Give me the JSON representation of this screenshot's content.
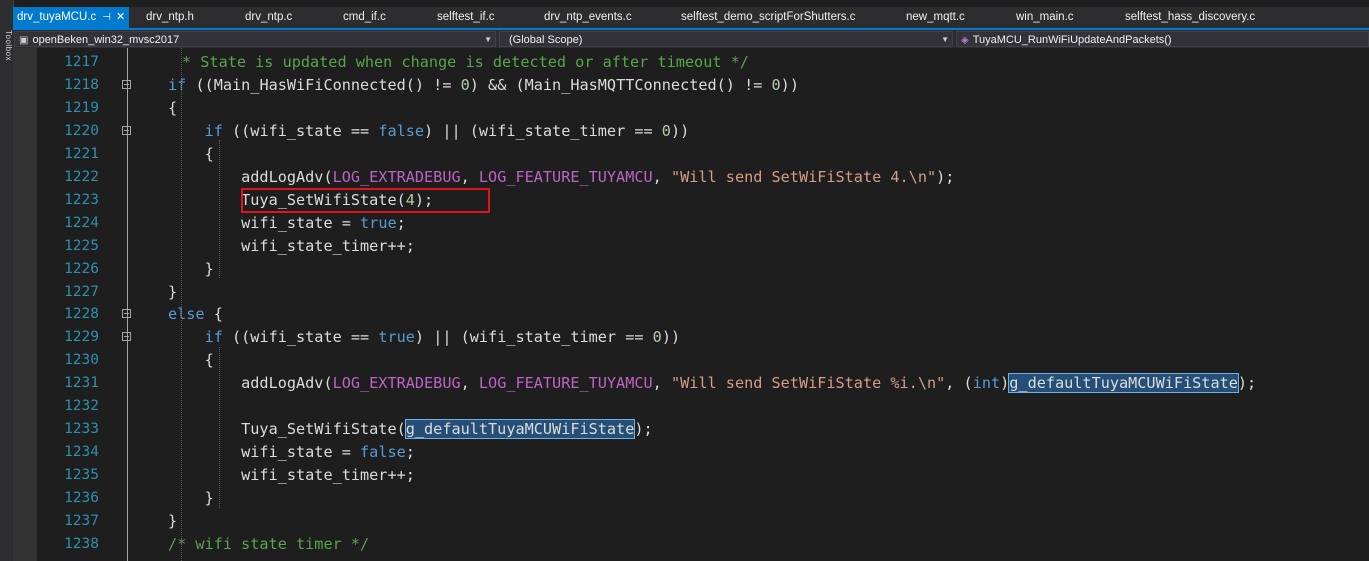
{
  "toolbox": {
    "label": "Toolbox"
  },
  "tabs": [
    {
      "label": "drv_tuyaMCU.c",
      "active": true,
      "pin": "⊣",
      "close": "✕"
    },
    {
      "label": "drv_ntp.h"
    },
    {
      "label": "drv_ntp.c"
    },
    {
      "label": "cmd_if.c"
    },
    {
      "label": "selftest_if.c"
    },
    {
      "label": "drv_ntp_events.c"
    },
    {
      "label": "selftest_demo_scriptForShutters.c"
    },
    {
      "label": "new_mqtt.c"
    },
    {
      "label": "win_main.c"
    },
    {
      "label": "selftest_hass_discovery.c"
    }
  ],
  "navbar": {
    "project": "openBeken_win32_mvsc2017",
    "scope": "(Global Scope)",
    "function": "TuyaMCU_RunWiFiUpdateAndPackets()"
  },
  "colors": {
    "accent": "#007acc",
    "highlight": "#e0141d",
    "line_number": "#2b91af"
  },
  "lines": [
    {
      "num": "1217",
      "segs": [
        [
          "cm",
          "* State is updated when change is detected or after timeout */"
        ]
      ],
      "indent": 1
    },
    {
      "num": "1218",
      "segs": [
        [
          "kw",
          "if"
        ],
        [
          "",
          " ((Main_HasWiFiConnected() != "
        ],
        [
          "num",
          "0"
        ],
        [
          "",
          ") && (Main_HasMQTTConnected() != "
        ],
        [
          "num",
          "0"
        ],
        [
          "",
          "))"
        ]
      ]
    },
    {
      "num": "1219",
      "segs": [
        [
          "",
          "{"
        ]
      ]
    },
    {
      "num": "1220",
      "segs": [
        [
          "",
          "    "
        ],
        [
          "kw",
          "if"
        ],
        [
          "",
          " ((wifi_state == "
        ],
        [
          "kw",
          "false"
        ],
        [
          "",
          ") || (wifi_state_timer == "
        ],
        [
          "num",
          "0"
        ],
        [
          "",
          "))"
        ]
      ]
    },
    {
      "num": "1221",
      "segs": [
        [
          "",
          "    {"
        ]
      ]
    },
    {
      "num": "1222",
      "segs": [
        [
          "",
          "        addLogAdv("
        ],
        [
          "mac",
          "LOG_EXTRADEBUG"
        ],
        [
          "",
          ", "
        ],
        [
          "mac",
          "LOG_FEATURE_TUYAMCU"
        ],
        [
          "",
          ", "
        ],
        [
          "str",
          "\"Will send SetWiFiState 4.\\n\""
        ],
        [
          "",
          ");"
        ]
      ]
    },
    {
      "num": "1223",
      "segs": [
        [
          "",
          "        Tuya_SetWifiState("
        ],
        [
          "num",
          "4"
        ],
        [
          "",
          ");"
        ]
      ]
    },
    {
      "num": "1224",
      "segs": [
        [
          "",
          "        wifi_state = "
        ],
        [
          "kw",
          "true"
        ],
        [
          "",
          ";"
        ]
      ]
    },
    {
      "num": "1225",
      "segs": [
        [
          "",
          "        wifi_state_timer++;"
        ]
      ]
    },
    {
      "num": "1226",
      "segs": [
        [
          "",
          "    }"
        ]
      ]
    },
    {
      "num": "1227",
      "segs": [
        [
          "",
          "}"
        ]
      ]
    },
    {
      "num": "1228",
      "segs": [
        [
          "kw",
          "else"
        ],
        [
          "",
          " {"
        ]
      ]
    },
    {
      "num": "1229",
      "segs": [
        [
          "",
          "    "
        ],
        [
          "kw",
          "if"
        ],
        [
          "",
          " ((wifi_state == "
        ],
        [
          "kw",
          "true"
        ],
        [
          "",
          ") || (wifi_state_timer == "
        ],
        [
          "num",
          "0"
        ],
        [
          "",
          "))"
        ]
      ]
    },
    {
      "num": "1230",
      "segs": [
        [
          "",
          "    {"
        ]
      ]
    },
    {
      "num": "1231",
      "segs": [
        [
          "",
          "        addLogAdv("
        ],
        [
          "mac",
          "LOG_EXTRADEBUG"
        ],
        [
          "",
          ", "
        ],
        [
          "mac",
          "LOG_FEATURE_TUYAMCU"
        ],
        [
          "",
          ", "
        ],
        [
          "str",
          "\"Will send SetWiFiState %i.\\n\""
        ],
        [
          "",
          ", ("
        ],
        [
          "kw",
          "int"
        ],
        [
          "",
          ")"
        ],
        [
          "hl",
          "g_defaultTuyaMCUWiFiState"
        ],
        [
          "",
          ");"
        ]
      ]
    },
    {
      "num": "1232",
      "segs": [
        [
          "",
          ""
        ]
      ]
    },
    {
      "num": "1233",
      "segs": [
        [
          "",
          "        Tuya_SetWifiState("
        ],
        [
          "hl",
          "g_defaultTuyaMCUWiFiState"
        ],
        [
          "",
          ");"
        ]
      ]
    },
    {
      "num": "1234",
      "segs": [
        [
          "",
          "        wifi_state = "
        ],
        [
          "kw",
          "false"
        ],
        [
          "",
          ";"
        ]
      ]
    },
    {
      "num": "1235",
      "segs": [
        [
          "",
          "        wifi_state_timer++;"
        ]
      ]
    },
    {
      "num": "1236",
      "segs": [
        [
          "",
          "    }"
        ]
      ]
    },
    {
      "num": "1237",
      "segs": [
        [
          "",
          "}"
        ]
      ]
    },
    {
      "num": "1238",
      "segs": [
        [
          "cm",
          "/* wifi state timer */"
        ]
      ]
    }
  ]
}
